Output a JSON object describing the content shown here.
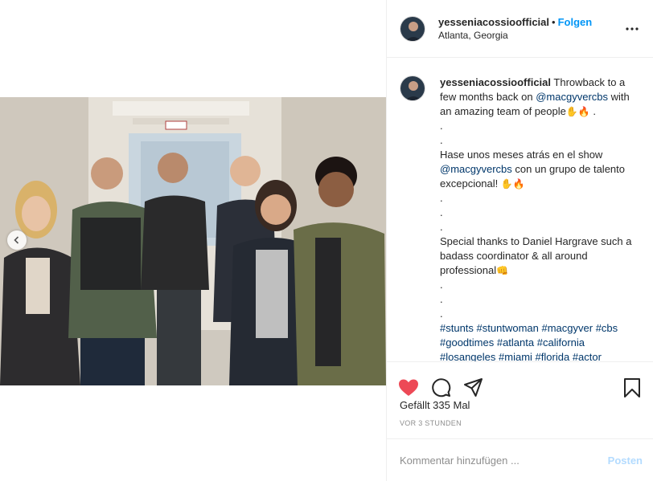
{
  "post": {
    "username": "yesseniacossioofficial",
    "separator": "•",
    "follow_label": "Folgen",
    "location": "Atlanta, Georgia",
    "more_icon": "more-horizontal-icon",
    "image_alt": "Group photo of six people in a hallway"
  },
  "caption": {
    "username": "yesseniacossioofficial",
    "line1_a": "Throwback to a few months back on ",
    "mention1": "@macgyvercbs",
    "line1_b": " with an amazing team of people",
    "emoji1": "✋🔥",
    "end1": " .",
    "dot1": ".",
    "dot2": ".",
    "para2_a": "Hase unos meses atrás en el show ",
    "mention2": "@macgyvercbs",
    "para2_b": " con un grupo de talento excepcional! ",
    "emoji2": "✋🔥",
    "dot3": ".",
    "dot4": ".",
    "dot5": ".",
    "para3": "Special thanks to Daniel Hargrave such a badass coordinator & all around professional",
    "emoji3": "👊",
    "dot6": ".",
    "dot7": ".",
    "dot8": ".",
    "tags": [
      "#stunts",
      "#stuntwoman",
      "#macgyver",
      "#cbs",
      "#goodtimes",
      "#atlanta",
      "#california",
      "#losangeles",
      "#miami",
      "#florida",
      "#actor"
    ]
  },
  "actions": {
    "like_icon": "heart-filled-icon",
    "comment_icon": "comment-icon",
    "share_icon": "share-icon",
    "save_icon": "bookmark-icon",
    "like_color": "#ed4956"
  },
  "likes_text": "Gefällt 335 Mal",
  "time_text": "VOR 3 STUNDEN",
  "comment": {
    "placeholder": "Kommentar hinzufügen ...",
    "post_label": "Posten"
  },
  "colors": {
    "link": "#0095f6",
    "hashtag": "#00376b",
    "muted": "#8e8e8e",
    "post_disabled": "#b3dbff"
  }
}
